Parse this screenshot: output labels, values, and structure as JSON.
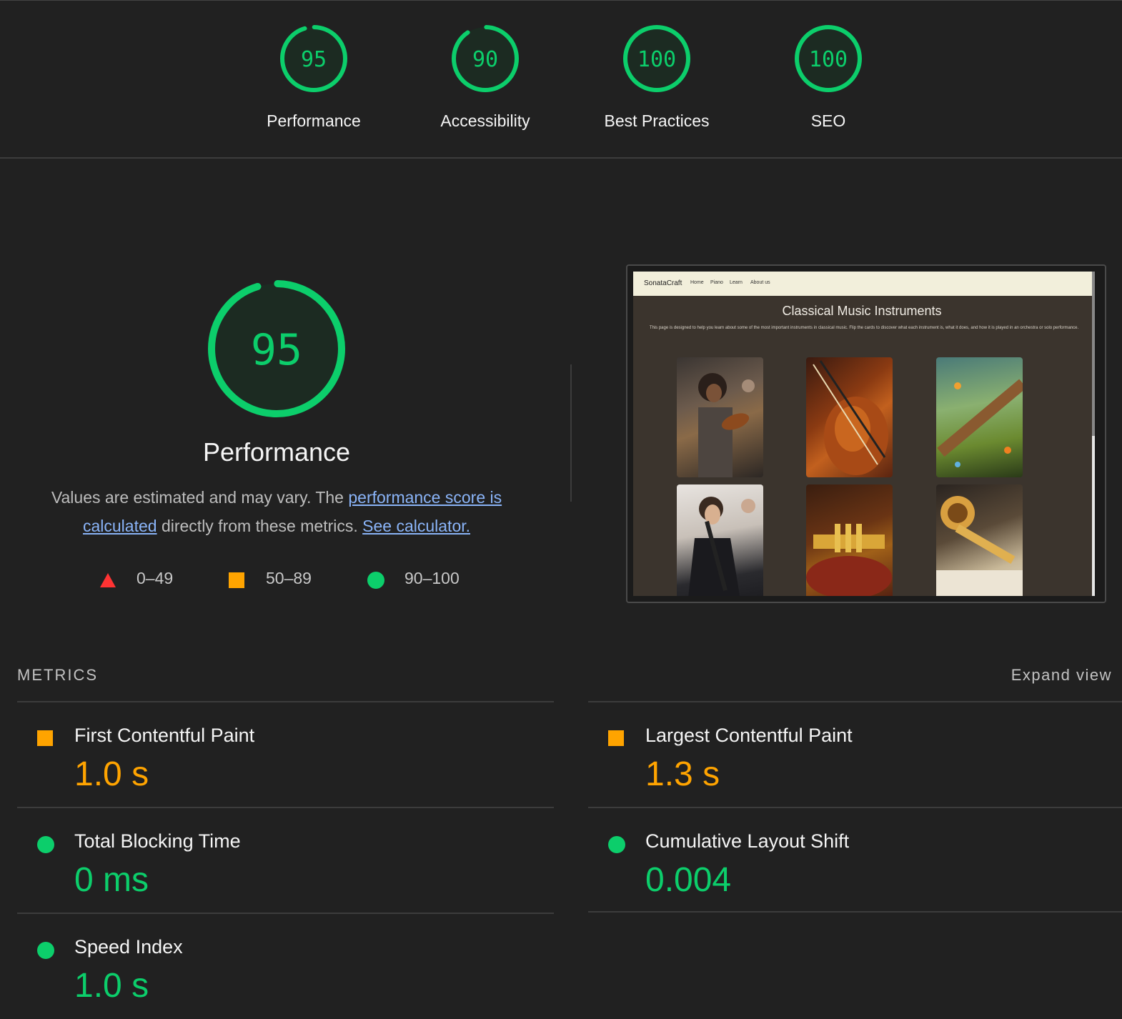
{
  "summary": {
    "gauges": [
      {
        "score": "95",
        "label": "Performance",
        "fraction": 0.95
      },
      {
        "score": "90",
        "label": "Accessibility",
        "fraction": 0.9
      },
      {
        "score": "100",
        "label": "Best Practices",
        "fraction": 1.0
      },
      {
        "score": "100",
        "label": "SEO",
        "fraction": 1.0
      }
    ]
  },
  "performance": {
    "score": "95",
    "fraction": 0.95,
    "title": "Performance",
    "desc_before": "Values are estimated and may vary. The ",
    "desc_link1": "performance score is calculated",
    "desc_middle": " directly from these metrics. ",
    "desc_link2": "See calculator."
  },
  "legend": [
    {
      "range": "0–49"
    },
    {
      "range": "50–89"
    },
    {
      "range": "90–100"
    }
  ],
  "screenshot": {
    "brand": "SonataCraft",
    "nav": [
      "Home",
      "Piano",
      "Learn",
      "About us"
    ],
    "title": "Classical Music Instruments",
    "description": "This page is designed to help you learn about some of the most important instruments in classical music. Flip the cards to discover what each instrument is, what it does, and how it is played in an orchestra or solo performance."
  },
  "metrics": {
    "heading": "METRICS",
    "expand_label": "Expand view",
    "items": [
      {
        "name": "First Contentful Paint",
        "value": "1.0 s",
        "status": "orange"
      },
      {
        "name": "Largest Contentful Paint",
        "value": "1.3 s",
        "status": "orange"
      },
      {
        "name": "Total Blocking Time",
        "value": "0 ms",
        "status": "green"
      },
      {
        "name": "Cumulative Layout Shift",
        "value": "0.004",
        "status": "green"
      },
      {
        "name": "Speed Index",
        "value": "1.0 s",
        "status": "green"
      }
    ]
  },
  "colors": {
    "pass": "#0cce6b",
    "average": "#ffa400",
    "fail": "#ff3333",
    "link": "#8ab4f8",
    "background": "#212121"
  }
}
